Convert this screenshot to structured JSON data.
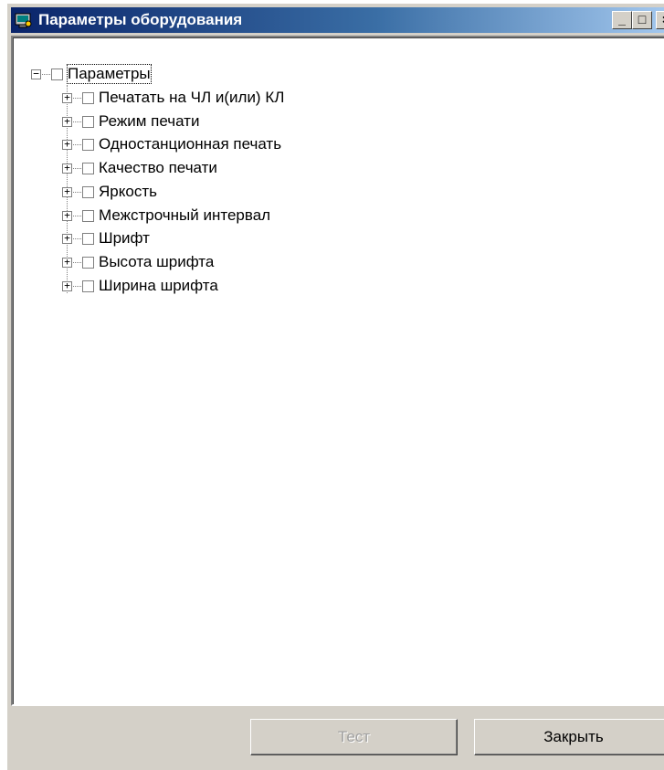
{
  "window": {
    "title": "Параметры оборудования",
    "controls": {
      "minimize": "_",
      "maximize": "□",
      "close": "×"
    }
  },
  "tree": {
    "root": {
      "label": "Параметры",
      "expanded": true,
      "checked": false,
      "selected": true
    },
    "items": [
      {
        "label": "Печатать на ЧЛ и(или) КЛ",
        "expanded": false,
        "checked": false
      },
      {
        "label": "Режим печати",
        "expanded": false,
        "checked": false
      },
      {
        "label": "Одностанционная печать",
        "expanded": false,
        "checked": false
      },
      {
        "label": "Качество печати",
        "expanded": false,
        "checked": false
      },
      {
        "label": "Яркость",
        "expanded": false,
        "checked": false
      },
      {
        "label": "Межстрочный интервал",
        "expanded": false,
        "checked": false
      },
      {
        "label": "Шрифт",
        "expanded": false,
        "checked": false
      },
      {
        "label": "Высота шрифта",
        "expanded": false,
        "checked": false
      },
      {
        "label": "Ширина шрифта",
        "expanded": false,
        "checked": false
      }
    ]
  },
  "buttons": {
    "test": {
      "label": "Тест",
      "enabled": false
    },
    "close": {
      "label": "Закрыть",
      "enabled": true
    }
  },
  "colors": {
    "titlebar_start": "#0a246a",
    "titlebar_end": "#a6caf0",
    "face": "#d4d0c8"
  }
}
